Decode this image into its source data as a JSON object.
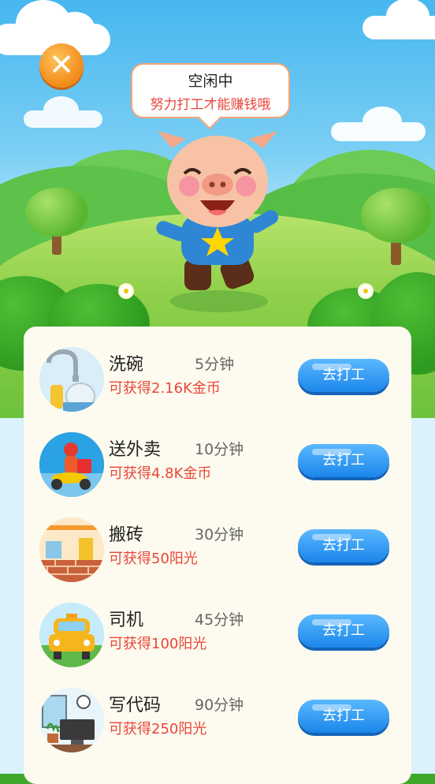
{
  "close_icon": "close-icon",
  "bubble": {
    "title": "空闲中",
    "subtitle": "努力打工才能赚钱哦"
  },
  "jobs": [
    {
      "name": "洗碗",
      "time": "5分钟",
      "reward": "可获得2.16K金币",
      "button": "去打工",
      "icon": "dishwashing-icon"
    },
    {
      "name": "送外卖",
      "time": "10分钟",
      "reward": "可获得4.8K金币",
      "button": "去打工",
      "icon": "delivery-icon"
    },
    {
      "name": "搬砖",
      "time": "30分钟",
      "reward": "可获得50阳光",
      "button": "去打工",
      "icon": "brick-icon"
    },
    {
      "name": "司机",
      "time": "45分钟",
      "reward": "可获得100阳光",
      "button": "去打工",
      "icon": "taxi-icon"
    },
    {
      "name": "写代码",
      "time": "90分钟",
      "reward": "可获得250阳光",
      "button": "去打工",
      "icon": "computer-icon"
    }
  ],
  "colors": {
    "reward": "#e8463b",
    "button": "#1b86ea",
    "close": "#f28a1a",
    "panel": "#fdfbef"
  }
}
